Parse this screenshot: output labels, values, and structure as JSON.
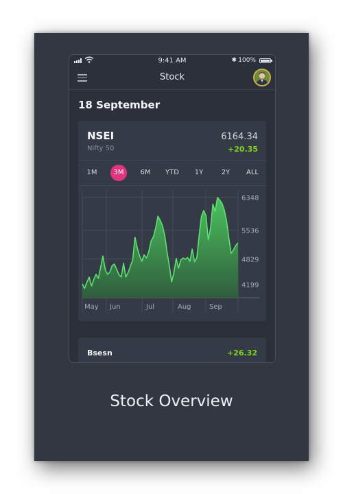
{
  "status_bar": {
    "time": "9:41 AM",
    "bluetooth": "✱",
    "battery": "100%"
  },
  "navbar": {
    "title": "Stock",
    "menu_icon": "hamburger-menu-icon",
    "avatar_icon": "user-avatar"
  },
  "date": "18 September",
  "stock": {
    "symbol": "NSEI",
    "name": "Nifty 50",
    "price": "6164.34",
    "change": "+20.35",
    "change_color": "#7ed321"
  },
  "ranges": [
    "1M",
    "3M",
    "6M",
    "YTD",
    "1Y",
    "2Y",
    "ALL"
  ],
  "active_range": "3M",
  "accent_color": "#e0357e",
  "chart_data": {
    "type": "area",
    "x_labels": [
      "May",
      "Jun",
      "Jul",
      "Aug",
      "Sep"
    ],
    "y_ticks": [
      6348,
      5536,
      4829,
      4199
    ],
    "ylim": [
      3870,
      6440
    ],
    "grid": true,
    "series": [
      {
        "values": [
          4210,
          4100,
          4250,
          4380,
          4160,
          4320,
          4450,
          4350,
          4620,
          4900,
          4560,
          4450,
          4500,
          4660,
          4700,
          4570,
          4440,
          4380,
          4720,
          4380,
          4490,
          4650,
          4800,
          5360,
          5100,
          4900,
          4770,
          4930,
          4850,
          5000,
          5260,
          5370,
          5580,
          5880,
          5780,
          5650,
          5400,
          5000,
          4650,
          4260,
          4490,
          4840,
          4600,
          4800,
          4850,
          4820,
          4860,
          4770,
          5070,
          4760,
          4850,
          5400,
          5870,
          6020,
          5890,
          5300,
          5580,
          6180,
          6000,
          6340,
          6280,
          6200,
          6030,
          5760,
          5340,
          4960,
          5050,
          5160,
          5220
        ]
      }
    ]
  },
  "second_stock": {
    "name": "Bsesn",
    "change": "+26.32"
  },
  "caption": "Stock Overview"
}
